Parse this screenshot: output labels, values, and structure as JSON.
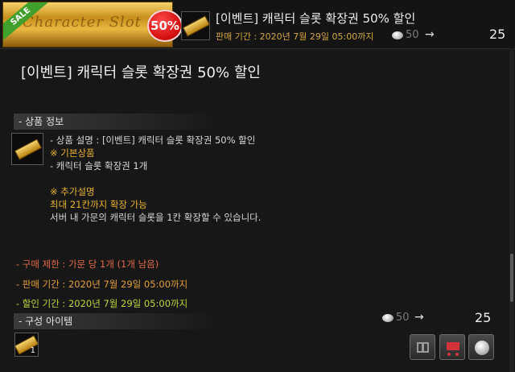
{
  "header": {
    "banner_text": "Character Slot",
    "sale_label": "SALE",
    "discount_badge": "50%",
    "title": "[이벤트] 캐릭터 슬롯 확장권 50% 할인",
    "sale_period": "판매 기간 : 2020년 7월 29일 05:00까지",
    "original_price": "50",
    "arrow": "→",
    "sale_price": "25"
  },
  "detail": {
    "title": "[이벤트] 캐릭터 슬롯 확장권 50% 할인",
    "product_info_header": "- 상품 정보",
    "info_lines": [
      "- 상품 설명 : [이벤트] 캐릭터 슬롯 확장권 50% 할인",
      "※ 기본상품",
      "- 캐릭터 슬롯 확장권 1개",
      "",
      "※ 추가설명",
      "최대 21칸까지 확장 가능",
      "서버 내 가문의 캐릭터 슬롯을 1칸 확장할 수 있습니다."
    ],
    "purchase_limit": "- 구매 제한 : 가문 당 1개 (1개 남음)",
    "sale_period": "- 판매 기간 : 2020년 7월 29일 05:00까지",
    "discount_period": "- 할인 기간 : 2020년 7월 29일 05:00까지",
    "original_price": "50",
    "arrow": "→",
    "sale_price": "25",
    "components_header": "- 구성 아이템",
    "component_count": "1"
  },
  "icons": {
    "gift": "gift-icon",
    "cart": "cart-icon",
    "coin": "silver-coin-icon"
  },
  "colors": {
    "sale_ribbon": "#3fa12c",
    "discount_badge": "#d40f0f",
    "gold_text": "#e8b32d",
    "limit_text": "#e26a4b",
    "period_text": "#e2a03a",
    "discount_period_text": "#b9d83a"
  }
}
